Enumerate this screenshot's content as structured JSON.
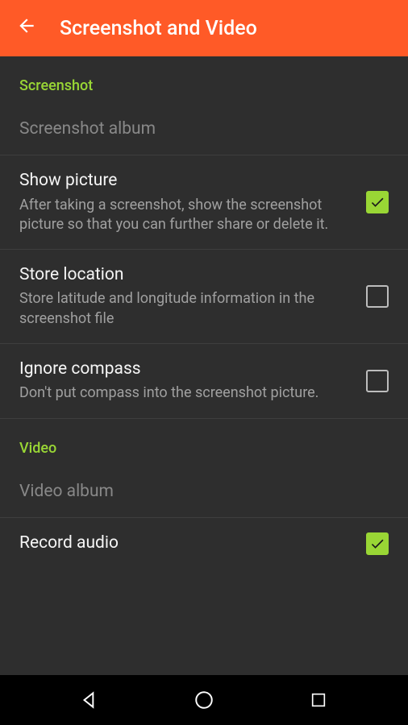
{
  "header": {
    "title": "Screenshot and Video"
  },
  "sections": {
    "screenshot": {
      "label": "Screenshot",
      "items": {
        "album": {
          "title": "Screenshot album"
        },
        "showPicture": {
          "title": "Show picture",
          "subtitle": "After taking a screenshot, show the screenshot picture so that you can further share or delete it.",
          "checked": true
        },
        "storeLocation": {
          "title": "Store location",
          "subtitle": "Store latitude and longitude information in the screenshot file",
          "checked": false
        },
        "ignoreCompass": {
          "title": "Ignore compass",
          "subtitle": "Don't put compass into the screenshot picture.",
          "checked": false
        }
      }
    },
    "video": {
      "label": "Video",
      "items": {
        "album": {
          "title": "Video album"
        },
        "recordAudio": {
          "title": "Record audio",
          "checked": true
        }
      }
    }
  }
}
